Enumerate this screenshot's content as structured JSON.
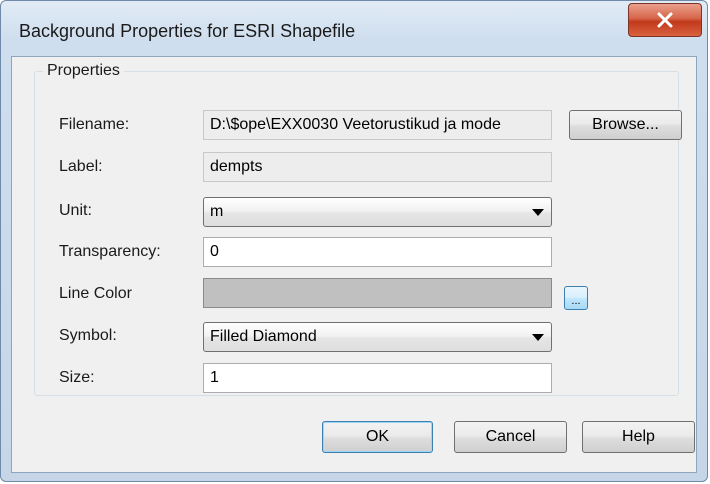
{
  "window": {
    "title": "Background Properties for ESRI Shapefile",
    "close_glyph": "X"
  },
  "group": {
    "label": "Properties"
  },
  "fields": {
    "filename": {
      "label": "Filename:",
      "value": "D:\\$ope\\EXX0030 Veetorustikud ja mode"
    },
    "label": {
      "label": "Label:",
      "value": "dempts"
    },
    "unit": {
      "label": "Unit:",
      "value": "m"
    },
    "transparency": {
      "label": "Transparency:",
      "value": "0"
    },
    "line_color": {
      "label": "Line Color",
      "color": "#c0c0c0"
    },
    "symbol": {
      "label": "Symbol:",
      "value": "Filled Diamond"
    },
    "size": {
      "label": "Size:",
      "value": "1"
    }
  },
  "buttons": {
    "browse": "Browse...",
    "color_picker": "...",
    "ok": "OK",
    "cancel": "Cancel",
    "help": "Help"
  }
}
